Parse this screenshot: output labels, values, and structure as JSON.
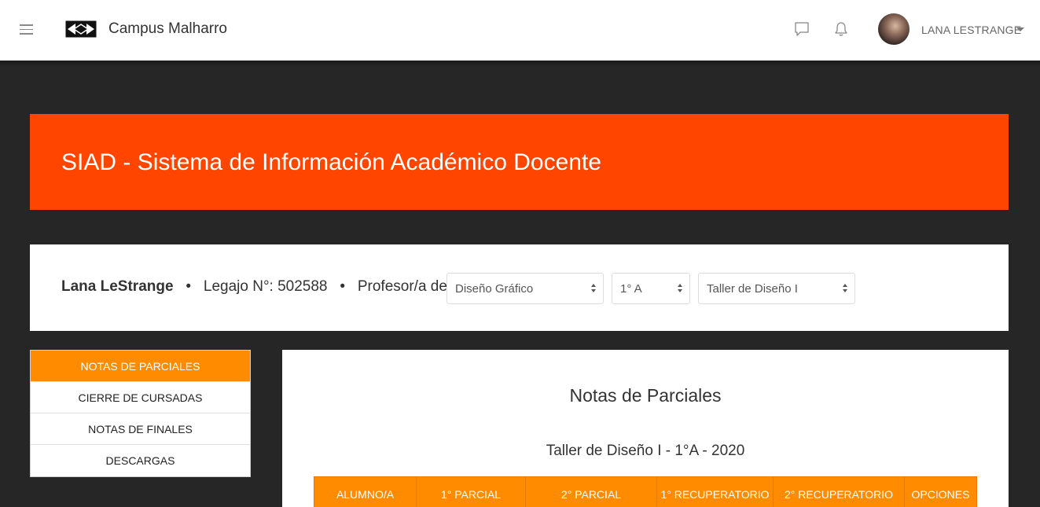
{
  "navbar": {
    "brand": "Campus Malharro",
    "user_name": "LANA LESTRANGE",
    "icons": [
      "menu-icon",
      "logo-icon",
      "chat-icon",
      "bell-icon",
      "caret-down-icon"
    ]
  },
  "banner": {
    "title": "SIAD - Sistema de Información Académico Docente",
    "color": "#ff4500"
  },
  "info": {
    "professor_name": "Lana LeStrange",
    "legajo_label": "Legajo N°: 502588",
    "profesor_label": "Profesor/a de",
    "selects": {
      "carrera": "Diseño Gráfico",
      "curso": "1° A",
      "materia": "Taller de Diseño I"
    }
  },
  "sidebar": {
    "items": [
      {
        "label": "NOTAS DE PARCIALES",
        "active": true
      },
      {
        "label": "CIERRE DE CURSADAS",
        "active": false
      },
      {
        "label": "NOTAS DE FINALES",
        "active": false
      },
      {
        "label": "DESCARGAS",
        "active": false
      }
    ],
    "accent": "#ff8c00"
  },
  "main": {
    "title": "Notas de Parciales",
    "subtitle": "Taller de Diseño I - 1°A - 2020",
    "table": {
      "headers": [
        "ALUMNO/A",
        "1° PARCIAL",
        "2° PARCIAL",
        "1° RECUPERATORIO",
        "2° RECUPERATORIO",
        "OPCIONES"
      ]
    }
  }
}
